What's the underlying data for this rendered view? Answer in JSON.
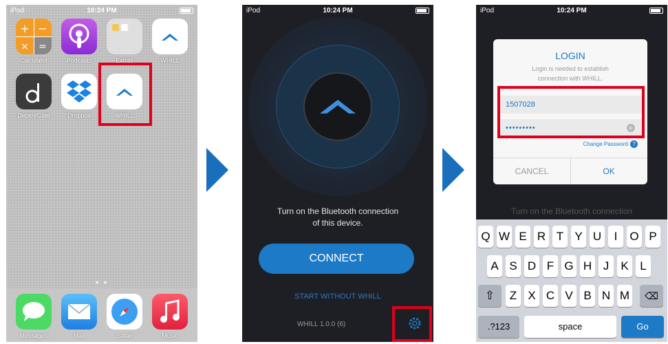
{
  "phone1": {
    "status": {
      "carrier": "iPod",
      "time": "10:24 PM"
    },
    "apps": [
      {
        "label": "Calculator"
      },
      {
        "label": "Podcasts"
      },
      {
        "label": "Extras"
      },
      {
        "label": "WHILL"
      },
      {
        "label": "DeployGate"
      },
      {
        "label": "Dropbox"
      },
      {
        "label": "WHILL"
      }
    ],
    "dock": [
      {
        "label": "Messages"
      },
      {
        "label": "Mail"
      },
      {
        "label": "Safari"
      },
      {
        "label": "Music"
      }
    ]
  },
  "phone2": {
    "status": {
      "carrier": "iPod",
      "time": "10:24 PM"
    },
    "message_line1": "Turn on the Bluetooth connection",
    "message_line2": "of this device.",
    "connect_label": "CONNECT",
    "start_label": "START WITHOUT WHILL",
    "version": "WHILL 1.0.0 (6)"
  },
  "phone3": {
    "status": {
      "carrier": "iPod",
      "time": "10:24 PM"
    },
    "dialog": {
      "title": "LOGIN",
      "subtitle_line1": "Login is needed to establish",
      "subtitle_line2": "connection with WHILL.",
      "user_value": "1507028",
      "password_value": "•••••••••",
      "change_password": "Change Password",
      "cancel": "CANCEL",
      "ok": "OK"
    },
    "behind_text": "Turn on the Bluetooth connection",
    "keyboard": {
      "row1": [
        "Q",
        "W",
        "E",
        "R",
        "T",
        "Y",
        "U",
        "I",
        "O",
        "P"
      ],
      "row2": [
        "A",
        "S",
        "D",
        "F",
        "G",
        "H",
        "J",
        "K",
        "L"
      ],
      "row3": [
        "Z",
        "X",
        "C",
        "V",
        "B",
        "N",
        "M"
      ],
      "mode_key": ".?123",
      "space_key": "space",
      "go_key": "Go"
    }
  },
  "colors": {
    "accent": "#1c7ac7",
    "highlight": "#e0001b",
    "arrow": "#1a6fbd"
  }
}
